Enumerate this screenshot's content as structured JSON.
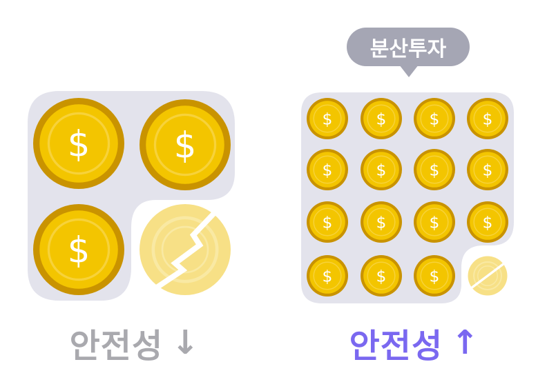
{
  "bubble": {
    "label": "분산투자",
    "color": "#a5a6b4"
  },
  "left_panel": {
    "caption": "안전성",
    "arrow": "↓",
    "caption_color": "#a9a9ae",
    "coins_total": 4,
    "broken_coins": 1,
    "coin_icon": "dollar-coin-icon",
    "broken_icon": "cracked-coin-icon"
  },
  "right_panel": {
    "caption": "안전성",
    "arrow": "↑",
    "caption_color": "#7a68f0",
    "coins_total": 16,
    "broken_coins": 1,
    "coin_icon": "dollar-coin-icon",
    "broken_icon": "cracked-coin-icon"
  },
  "coin": {
    "symbol": "$"
  },
  "colors": {
    "panel_bg": "#e3e3ec",
    "coin_outer": "#c99300",
    "coin_face": "#f3c500",
    "coin_inner": "#f7d23a",
    "coin_symbol": "#ffffff",
    "broken_face": "#f7e086",
    "broken_ring": "#f9e9a3"
  }
}
